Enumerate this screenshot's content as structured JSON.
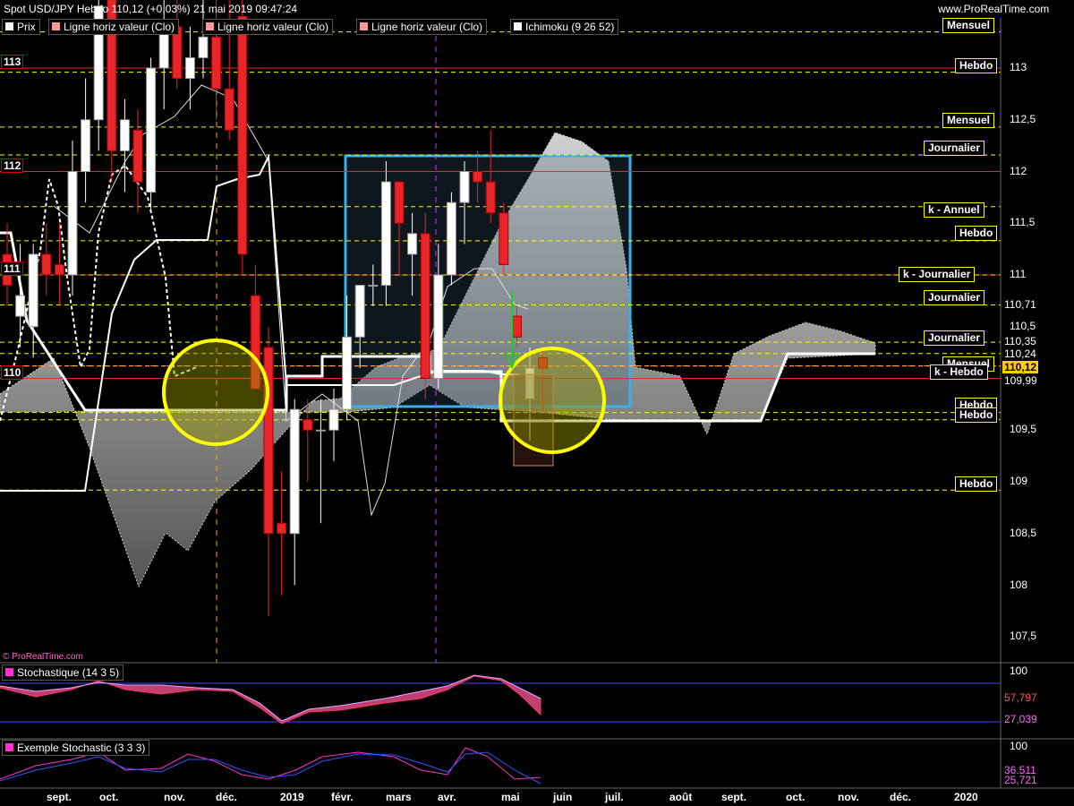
{
  "header": {
    "title": "Spot USD/JPY Hebdo 110,12 (+0,03%) 21 mai 2019 09:47:24",
    "site": "www.ProRealTime.com",
    "watermark": "© ProRealTime.com"
  },
  "legend": [
    {
      "label": "Prix",
      "color": "#ffffff"
    },
    {
      "label": "Ligne horiz valeur (Clo)",
      "color": "#ff9999"
    },
    {
      "label": "Ligne horiz valeur (Clo)",
      "color": "#ff9999"
    },
    {
      "label": "Ligne horiz valeur (Clo)",
      "color": "#ff9999"
    },
    {
      "label": "Ichimoku (9 26 52)",
      "color": "#ffffff"
    }
  ],
  "level_tags": [
    "Mensuel",
    "Hebdo",
    "Mensuel",
    "Journalier",
    "k - Annuel",
    "Hebdo",
    "k - Journalier",
    "Journalier",
    "Journalier",
    "Mensuel",
    "k - Hebdo",
    "Hebdo",
    "Hebdo",
    "Hebdo"
  ],
  "left_levels": [
    "113",
    "112",
    "111",
    "110"
  ],
  "price_boxes": {
    "p1": "110,71",
    "p2": "110,35",
    "p3": "110,24",
    "current": "110,12",
    "p4": "109,99"
  },
  "panels": {
    "stoch1": {
      "label": "Stochastique (14 3 5)",
      "top_tick": "100",
      "v1": "57,797",
      "v2": "27,039"
    },
    "stoch2": {
      "label": "Exemple Stochastic (3 3 3)",
      "top_tick": "100",
      "v1": "36,511",
      "v2": "25,721"
    }
  },
  "colors": {
    "bull": "#ffffff",
    "bear": "#e8262a",
    "level": "#ffff00",
    "resistance": "#e8262a",
    "box": "#3ab0e8",
    "circle": "#ffff00",
    "cloud": "#9a9a9a"
  },
  "chart_data": {
    "type": "candlestick",
    "title": "Spot USD/JPY Hebdo 110,12 (+0,03%) 21 mai 2019 09:47:24",
    "ylim": [
      107.2,
      113.6
    ],
    "y_ticks": [
      "113",
      "112,5",
      "112",
      "111,5",
      "111",
      "110,5",
      "110",
      "109,5",
      "109",
      "108,5",
      "108",
      "107,5"
    ],
    "x_ticks": [
      "sept.",
      "oct.",
      "nov.",
      "déc.",
      "2019",
      "févr.",
      "mars",
      "avr.",
      "mai",
      "juin",
      "juil.",
      "août",
      "sept.",
      "oct.",
      "nov.",
      "déc.",
      "2020"
    ],
    "horizontal_levels": [
      {
        "label": "Mensuel",
        "value": 113.35
      },
      {
        "label": "Hebdo",
        "value": 112.96
      },
      {
        "label": "Mensuel",
        "value": 112.43
      },
      {
        "label": "Journalier",
        "value": 112.16
      },
      {
        "label": "k - Annuel",
        "value": 111.66
      },
      {
        "label": "Hebdo",
        "value": 111.33
      },
      {
        "label": "k - Journalier",
        "value": 111.0
      },
      {
        "label": "Journalier",
        "value": 110.71
      },
      {
        "label": "Journalier",
        "value": 110.35
      },
      {
        "label": "Mensuel",
        "value": 110.24
      },
      {
        "label": "k - Hebdo",
        "value": 110.12
      },
      {
        "label": "Hebdo",
        "value": 109.67
      },
      {
        "label": "Hebdo",
        "value": 109.6
      },
      {
        "label": "Hebdo",
        "value": 108.92
      }
    ],
    "resistance_levels": [
      113,
      112,
      111,
      110
    ],
    "candles": [
      {
        "o": 111.2,
        "h": 111.5,
        "l": 110.7,
        "c": 110.9
      },
      {
        "o": 110.6,
        "h": 111.3,
        "l": 110.3,
        "c": 110.8
      },
      {
        "o": 110.5,
        "h": 111.3,
        "l": 110.2,
        "c": 111.2
      },
      {
        "o": 111.2,
        "h": 111.5,
        "l": 110.8,
        "c": 111.0
      },
      {
        "o": 111.1,
        "h": 111.5,
        "l": 110.7,
        "c": 111.0
      },
      {
        "o": 111.0,
        "h": 112.3,
        "l": 110.8,
        "c": 112.0
      },
      {
        "o": 112.0,
        "h": 112.9,
        "l": 111.7,
        "c": 112.5
      },
      {
        "o": 112.5,
        "h": 113.7,
        "l": 112.2,
        "c": 113.6
      },
      {
        "o": 113.7,
        "h": 113.8,
        "l": 111.9,
        "c": 112.2
      },
      {
        "o": 112.2,
        "h": 112.7,
        "l": 111.8,
        "c": 112.5
      },
      {
        "o": 112.4,
        "h": 112.6,
        "l": 111.6,
        "c": 111.9
      },
      {
        "o": 111.8,
        "h": 113.1,
        "l": 111.6,
        "c": 113.0
      },
      {
        "o": 113.0,
        "h": 113.7,
        "l": 112.6,
        "c": 113.4
      },
      {
        "o": 113.4,
        "h": 113.7,
        "l": 112.8,
        "c": 112.9
      },
      {
        "o": 112.9,
        "h": 113.4,
        "l": 112.6,
        "c": 113.1
      },
      {
        "o": 113.1,
        "h": 113.8,
        "l": 112.9,
        "c": 113.3
      },
      {
        "o": 113.3,
        "h": 113.8,
        "l": 112.5,
        "c": 112.8
      },
      {
        "o": 112.8,
        "h": 113.7,
        "l": 112.3,
        "c": 112.4
      },
      {
        "o": 113.5,
        "h": 113.7,
        "l": 111.0,
        "c": 111.2
      },
      {
        "o": 110.8,
        "h": 111.1,
        "l": 110.0,
        "c": 109.9
      },
      {
        "o": 110.3,
        "h": 110.5,
        "l": 107.7,
        "c": 108.5
      },
      {
        "o": 108.6,
        "h": 109.1,
        "l": 107.9,
        "c": 108.5
      },
      {
        "o": 108.5,
        "h": 109.8,
        "l": 108.0,
        "c": 109.7
      },
      {
        "o": 109.6,
        "h": 109.8,
        "l": 109.0,
        "c": 109.5
      },
      {
        "o": 109.5,
        "h": 109.8,
        "l": 108.6,
        "c": 109.5
      },
      {
        "o": 109.5,
        "h": 109.9,
        "l": 109.2,
        "c": 109.7
      },
      {
        "o": 109.7,
        "h": 110.8,
        "l": 109.6,
        "c": 110.4
      },
      {
        "o": 110.4,
        "h": 110.9,
        "l": 110.1,
        "c": 110.9
      },
      {
        "o": 110.9,
        "h": 111.1,
        "l": 110.7,
        "c": 110.9
      },
      {
        "o": 110.9,
        "h": 112.1,
        "l": 110.7,
        "c": 111.9
      },
      {
        "o": 111.9,
        "h": 111.9,
        "l": 111.0,
        "c": 111.5
      },
      {
        "o": 111.2,
        "h": 111.6,
        "l": 110.8,
        "c": 111.4
      },
      {
        "o": 111.4,
        "h": 111.6,
        "l": 109.8,
        "c": 110.0
      },
      {
        "o": 110.0,
        "h": 111.3,
        "l": 109.9,
        "c": 111.0
      },
      {
        "o": 111.0,
        "h": 111.8,
        "l": 110.9,
        "c": 111.7
      },
      {
        "o": 111.7,
        "h": 112.1,
        "l": 111.3,
        "c": 112.0
      },
      {
        "o": 112.0,
        "h": 112.2,
        "l": 111.7,
        "c": 111.9
      },
      {
        "o": 111.9,
        "h": 112.4,
        "l": 111.5,
        "c": 111.6
      },
      {
        "o": 111.6,
        "h": 111.7,
        "l": 111.0,
        "c": 111.1
      },
      {
        "o": 110.6,
        "h": 110.7,
        "l": 110.3,
        "c": 110.4
      },
      {
        "o": 109.8,
        "h": 110.3,
        "l": 109.4,
        "c": 110.1
      },
      {
        "o": 110.2,
        "h": 110.3,
        "l": 109.7,
        "c": 110.1
      }
    ]
  }
}
